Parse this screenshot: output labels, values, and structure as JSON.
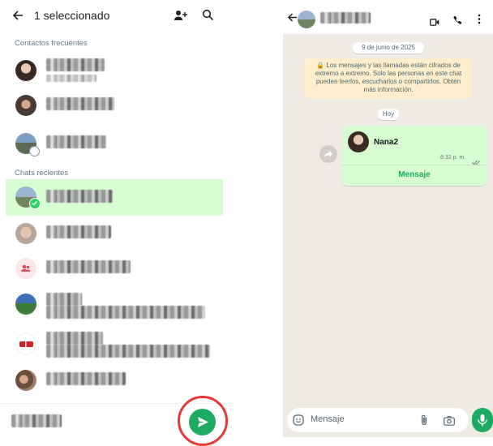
{
  "left": {
    "header_title": "1 seleccionado",
    "section_frequent": "Contactos frecuentes",
    "section_recent": "Chats recientes",
    "accent": "#25d366",
    "selected_bg": "#d9fdd3",
    "send_color": "#1daa61",
    "highlight_circle": "#e53935"
  },
  "right": {
    "date_pill": "9 de junio de 2025",
    "encryption_notice": "🔒 Los mensajes y las llamadas están cifrados de extremo a extremo. Solo las personas en este chat pueden leerlos, escucharlos o compartirlos. Obtén más información.",
    "today_pill": "Hoy",
    "contact_card_name": "Nana2",
    "message_time": "8:32 p. m.",
    "contact_card_action": "Mensaje",
    "composer_placeholder": "Mensaje"
  }
}
